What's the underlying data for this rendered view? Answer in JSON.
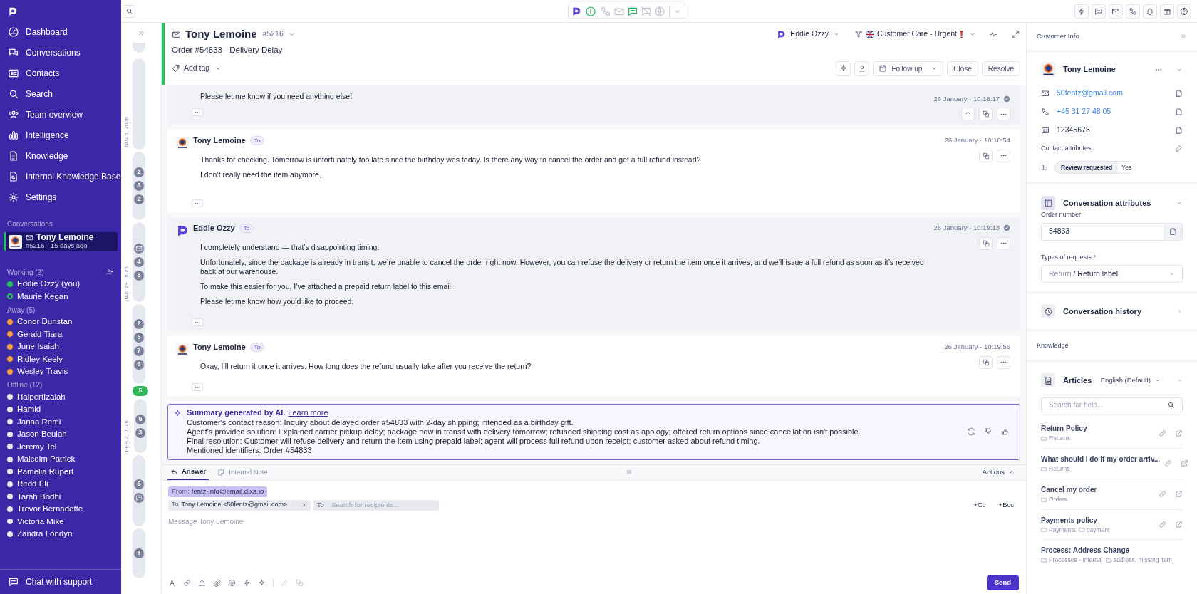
{
  "top_bar": {
    "channels": [
      {
        "kind": "status",
        "on": true
      },
      {
        "kind": "phone",
        "on": false
      },
      {
        "kind": "mail",
        "on": false
      },
      {
        "kind": "chat",
        "on": true
      },
      {
        "kind": "messenger",
        "on": false
      },
      {
        "kind": "web",
        "on": false
      }
    ]
  },
  "sidebar": {
    "nav": [
      {
        "label": "Dashboard"
      },
      {
        "label": "Conversations"
      },
      {
        "label": "Contacts"
      },
      {
        "label": "Search"
      },
      {
        "label": "Team overview"
      },
      {
        "label": "Intelligence"
      },
      {
        "label": "Knowledge"
      },
      {
        "label": "Internal Knowledge Base"
      },
      {
        "label": "Settings"
      }
    ],
    "conversations_label": "Conversations",
    "active_conversation": {
      "name": "Tony Lemoine",
      "meta": "#5216 · 15 days ago"
    },
    "agent_groups": [
      {
        "label": "Working (2)",
        "agents": [
          {
            "name": "Eddie Ozzy (you)",
            "color": "#22c55e",
            "hollow": false
          },
          {
            "name": "Maurie Kegan",
            "color": "#22c55e",
            "hollow": true
          }
        ]
      },
      {
        "label": "Away (5)",
        "agents": [
          {
            "name": "Conor Dunstan",
            "color": "#f59e3b",
            "hollow": false
          },
          {
            "name": "Gerald Tiara",
            "color": "#f59e3b",
            "hollow": false
          },
          {
            "name": "June Isaiah",
            "color": "#f59e3b",
            "hollow": false
          },
          {
            "name": "Ridley Keely",
            "color": "#f59e3b",
            "hollow": false
          },
          {
            "name": "Wesley Travis",
            "color": "#f59e3b",
            "hollow": false
          }
        ]
      },
      {
        "label": "Offline (12)",
        "agents": [
          {
            "name": "HalpertIzaiah",
            "color": "#e5e7eb",
            "hollow": false
          },
          {
            "name": "Hamid",
            "color": "#e5e7eb",
            "hollow": false
          },
          {
            "name": "Janna Remi",
            "color": "#e5e7eb",
            "hollow": false
          },
          {
            "name": "Jason Beulah",
            "color": "#e5e7eb",
            "hollow": false
          },
          {
            "name": "Jeremy Tel",
            "color": "#e5e7eb",
            "hollow": false
          },
          {
            "name": "Malcolm Patrick",
            "color": "#e5e7eb",
            "hollow": false
          },
          {
            "name": "Pamelia Rupert",
            "color": "#e5e7eb",
            "hollow": false
          },
          {
            "name": "Redd Eli",
            "color": "#e5e7eb",
            "hollow": false
          },
          {
            "name": "Tarah Bodhi",
            "color": "#e5e7eb",
            "hollow": false
          },
          {
            "name": "Trevor Bernadette",
            "color": "#e5e7eb",
            "hollow": false
          },
          {
            "name": "Victoria Mike",
            "color": "#e5e7eb",
            "hollow": false
          },
          {
            "name": "Zandra Londyn",
            "color": "#e5e7eb",
            "hollow": false
          }
        ]
      }
    ],
    "support": "Chat with support"
  },
  "timeline": {
    "segments": [
      {
        "date": "JAN 5, 2026"
      },
      {
        "badges": [
          {
            "kind": "count",
            "text": "2",
            "selected": false
          },
          {
            "kind": "count",
            "text": "6",
            "selected": false
          },
          {
            "kind": "count",
            "text": "2",
            "selected": false
          }
        ]
      },
      {
        "date": "JAN 19, 2026",
        "badges": [
          {
            "kind": "mail",
            "selected": false
          },
          {
            "kind": "count",
            "text": "4",
            "selected": false
          },
          {
            "kind": "count",
            "text": "8",
            "selected": false
          }
        ]
      },
      {
        "badges": [
          {
            "kind": "count",
            "text": "2",
            "selected": false
          },
          {
            "kind": "count",
            "text": "5",
            "selected": false
          },
          {
            "kind": "count",
            "text": "7",
            "selected": false
          },
          {
            "kind": "count",
            "text": "6",
            "selected": false
          }
        ]
      },
      {
        "date": "FEB 2, 2026",
        "badges": [
          {
            "kind": "count",
            "text": "5",
            "selected": true
          },
          {
            "kind": "count",
            "text": "6",
            "selected": false
          },
          {
            "kind": "count",
            "text": "3",
            "selected": false
          }
        ]
      },
      {
        "badges": [
          {
            "kind": "count",
            "text": "5",
            "selected": false
          },
          {
            "kind": "chat",
            "selected": false
          }
        ]
      },
      {
        "badges": [
          {
            "kind": "count",
            "text": "6",
            "selected": false
          }
        ]
      }
    ]
  },
  "conversation": {
    "customer": "Tony Lemoine",
    "number": "#5216",
    "subject": "Order #54833 - Delivery Delay",
    "assignee": "Eddie Ozzy",
    "queue": "Customer Care - Urgent",
    "add_tag": "Add tag",
    "follow_up": "Follow up",
    "buttons": [
      "Close",
      "Resolve"
    ],
    "messages": [
      {
        "kind": "agent",
        "paragraphs": [
          "Please let me know if you need anything else!"
        ],
        "time": "26 January · 10:18:17",
        "read": true,
        "scroll_top": true
      },
      {
        "kind": "customer",
        "author": "Tony Lemoine",
        "badge": "To",
        "paragraphs": [
          "Thanks for checking. Tomorrow is unfortunately too late since the birthday was today. Is there any way to cancel the order and get a full refund instead?",
          "I don’t really need the item anymore."
        ],
        "time": "26 January · 10:18:54",
        "read": false,
        "scroll_top": false
      },
      {
        "kind": "agent",
        "author": "Eddie Ozzy",
        "badge": "To",
        "paragraphs": [
          "I completely understand — that’s disappointing timing.",
          "Unfortunately, since the package is already in transit, we’re unable to cancel the order right now. However, you can refuse the delivery or return the item once it arrives, and we’ll issue a full refund as soon as it’s received back at our warehouse.",
          "To make this easier for you, I’ve attached a prepaid return label to this email.",
          "Please let me know how you’d like to proceed."
        ],
        "time": "26 January · 10:19:13",
        "read": true,
        "scroll_top": false
      },
      {
        "kind": "customer",
        "author": "Tony Lemoine",
        "badge": "To",
        "paragraphs": [
          "Okay, I’ll return it once it arrives. How long does the refund usually take after you receive the return?"
        ],
        "time": "26 January · 10:19:56",
        "read": false,
        "scroll_top": false
      }
    ],
    "summary": {
      "title": "Summary generated by AI.",
      "link": "Learn more",
      "lines": [
        "Customer's contact reason: Inquiry about delayed order #54833 with 2-day shipping; intended as a birthday gift.",
        "Agent's provided solution: Explained carrier pickup delay; package now in transit with delivery tomorrow; refunded shipping cost as apology; offered return options since cancellation isn't possible.",
        "Final resolution: Customer will refuse delivery and return the item using prepaid label; agent will process full refund upon receipt; customer asked about refund timing.",
        "Mentioned identifiers: Order #54833"
      ]
    },
    "composer": {
      "tabs": [
        {
          "label": "Answer",
          "selected": true
        },
        {
          "label": "Internal Note",
          "selected": false
        }
      ],
      "actions": "Actions",
      "from_label": "From:",
      "from": "fentz-info@email.dixa.io",
      "to_label": "To",
      "to": "Tony Lemoine <50fentz@gmail.com>",
      "to_field_label": "To",
      "recipients_placeholder": "Search for recipients...",
      "cc": "+Cc",
      "bcc": "+Bcc",
      "message_placeholder": "Message Tony Lemoine",
      "send": "Send"
    }
  },
  "customer_info": {
    "title": "Customer Info",
    "name": "Tony Lemoine",
    "email": "50fentz@gmail.com",
    "phone": "+45 31 27 48 05",
    "id": "12345678",
    "contact_attributes_label": "Contact attributes",
    "attributes": [
      {
        "name": "Review requested",
        "value": "Yes"
      }
    ],
    "conversation_attributes": {
      "title": "Conversation attributes",
      "fields": [
        {
          "kind": "text",
          "label": "Order number",
          "value": "54833"
        },
        {
          "kind": "select",
          "label": "Types of requests *",
          "parent": "Return",
          "value": "/ Return label"
        }
      ]
    },
    "history": "Conversation history",
    "knowledge_label": "Knowledge",
    "articles": {
      "title": "Articles",
      "language": "English (Default)",
      "search_placeholder": "Search for help...",
      "items": [
        {
          "title": "Return Policy",
          "folders": [
            "Returns"
          ],
          "actions": true
        },
        {
          "title": "What should I do if my order arriv...",
          "folders": [
            "Returns"
          ],
          "actions": true
        },
        {
          "title": "Cancel my order",
          "folders": [
            "Orders"
          ],
          "actions": true
        },
        {
          "title": "Payments policy",
          "folders": [
            "Payments",
            "payment"
          ],
          "actions": true
        },
        {
          "title": "Process: Address Change",
          "folders": [
            "Processes - Internal",
            "address, missing item"
          ],
          "actions": false
        }
      ]
    }
  }
}
